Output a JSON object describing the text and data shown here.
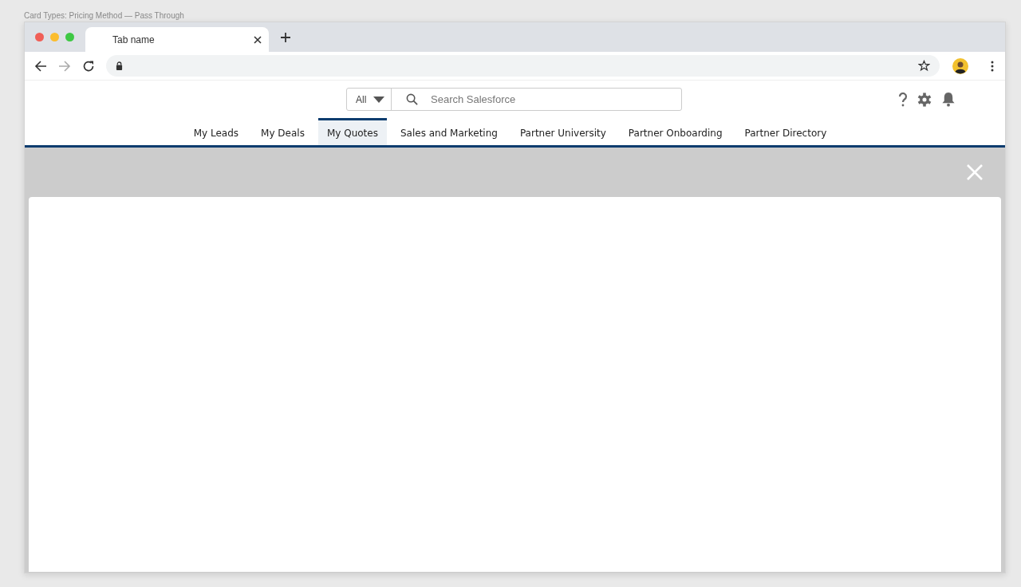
{
  "caption": "Card Types: Pricing Method — Pass Through",
  "browser": {
    "tab_title": "Tab name"
  },
  "search": {
    "scope": "All",
    "placeholder": "Search Salesforce"
  },
  "nav": [
    {
      "label": "My Leads",
      "selected": false
    },
    {
      "label": "My Deals",
      "selected": false
    },
    {
      "label": "My Quotes",
      "selected": true
    },
    {
      "label": "Sales and Marketing",
      "selected": false
    },
    {
      "label": "Partner University",
      "selected": false
    },
    {
      "label": "Partner Onboarding",
      "selected": false
    },
    {
      "label": "Partner Directory",
      "selected": false
    }
  ]
}
